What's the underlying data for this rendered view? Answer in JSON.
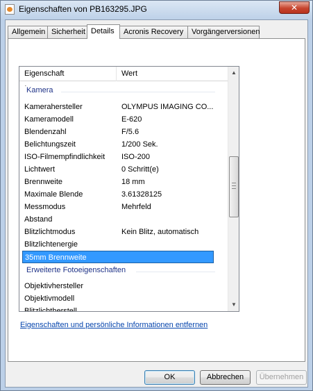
{
  "window": {
    "title": "Eigenschaften von PB163295.JPG",
    "close_label": "✕"
  },
  "tabs": [
    {
      "label": "Allgemein"
    },
    {
      "label": "Sicherheit"
    },
    {
      "label": "Details"
    },
    {
      "label": "Acronis Recovery"
    },
    {
      "label": "Vorgängerversionen"
    }
  ],
  "listview": {
    "headers": {
      "property": "Eigenschaft",
      "value": "Wert"
    },
    "groups": {
      "camera": "Kamera",
      "extended": "Erweiterte Fotoeigenschaften"
    },
    "rows": [
      {
        "property": "Kamerahersteller",
        "value": "OLYMPUS IMAGING CO..."
      },
      {
        "property": "Kameramodell",
        "value": "E-620"
      },
      {
        "property": "Blendenzahl",
        "value": "F/5.6"
      },
      {
        "property": "Belichtungszeit",
        "value": "1/200 Sek."
      },
      {
        "property": "ISO-Filmempfindlichkeit",
        "value": "ISO-200"
      },
      {
        "property": "Lichtwert",
        "value": "0 Schritt(e)"
      },
      {
        "property": "Brennweite",
        "value": "18 mm"
      },
      {
        "property": "Maximale Blende",
        "value": "3.61328125"
      },
      {
        "property": "Messmodus",
        "value": "Mehrfeld"
      },
      {
        "property": "Abstand",
        "value": ""
      },
      {
        "property": "Blitzlichtmodus",
        "value": "Kein Blitz, automatisch"
      },
      {
        "property": "Blitzlichtenergie",
        "value": ""
      },
      {
        "property": "35mm Brennweite",
        "value": ""
      }
    ],
    "extended_rows": [
      {
        "property": "Objektivhersteller",
        "value": ""
      },
      {
        "property": "Objektivmodell",
        "value": ""
      },
      {
        "property": "Blitzlichtherstell",
        "value": ""
      }
    ],
    "selected_row": "35mm Brennweite"
  },
  "link": {
    "label": "Eigenschaften und persönliche Informationen entfernen"
  },
  "buttons": {
    "ok": "OK",
    "cancel": "Abbrechen",
    "apply": "Übernehmen"
  },
  "colors": {
    "selection": "#3399ff",
    "group_text": "#1e3287",
    "link": "#0645ad"
  }
}
